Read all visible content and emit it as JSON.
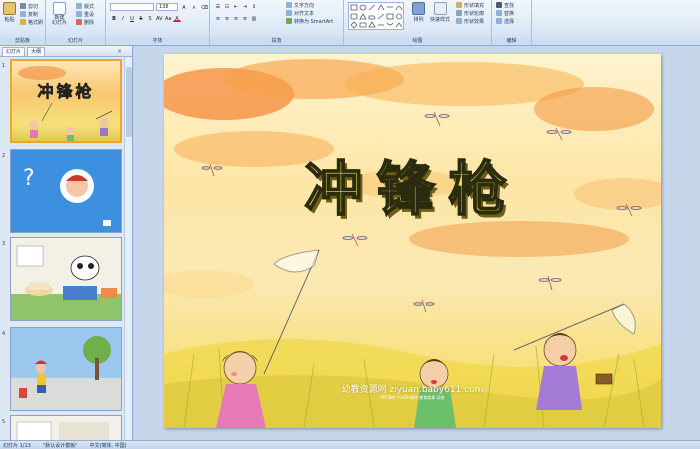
{
  "ribbon": {
    "clipboard": {
      "paste": "粘贴",
      "cut": "剪切",
      "copy": "复制",
      "format_painter": "格式刷",
      "label": "剪贴板"
    },
    "slides": {
      "new_slide": "新建\n幻灯片",
      "layout": "版式",
      "reset": "重设",
      "delete": "删除",
      "label": "幻灯片"
    },
    "font": {
      "font_name": "",
      "font_size": "138",
      "label": "字体"
    },
    "paragraph": {
      "text_direction": "文字方向",
      "align_text": "对齐文本",
      "smartart": "转换为 SmartArt",
      "label": "段落"
    },
    "drawing": {
      "arrange": "排列",
      "quick_styles": "快速样式",
      "shape_fill": "形状填充",
      "shape_outline": "形状轮廓",
      "shape_effects": "形状效果",
      "label": "绘图"
    },
    "editing": {
      "find": "查找",
      "replace": "替换",
      "select": "选择",
      "label": "编辑"
    }
  },
  "pane": {
    "tabs": [
      "幻灯片",
      "大纲"
    ],
    "close": "×",
    "slide_numbers": [
      "1",
      "2",
      "3",
      "4",
      "5"
    ],
    "thumb1_title": "冲锋枪",
    "thumb2_question": "?"
  },
  "slide": {
    "title": "冲锋枪",
    "watermark": "幼教资源网 ziyuan.baby611.com",
    "watermark_sub": "PPT课件    FLASH课件    教育故事    试卷"
  },
  "status": {
    "slide_counter": "幻灯片 1/13",
    "theme": "\"默认设计模板\"",
    "language": "中文(简体, 中国)"
  },
  "colors": {
    "ribbon_bg": "#dbe7f5",
    "selected_border": "#f3a32c",
    "title_fill": "#f0ef3a",
    "thumb2_bg": "#3d8fe0"
  }
}
